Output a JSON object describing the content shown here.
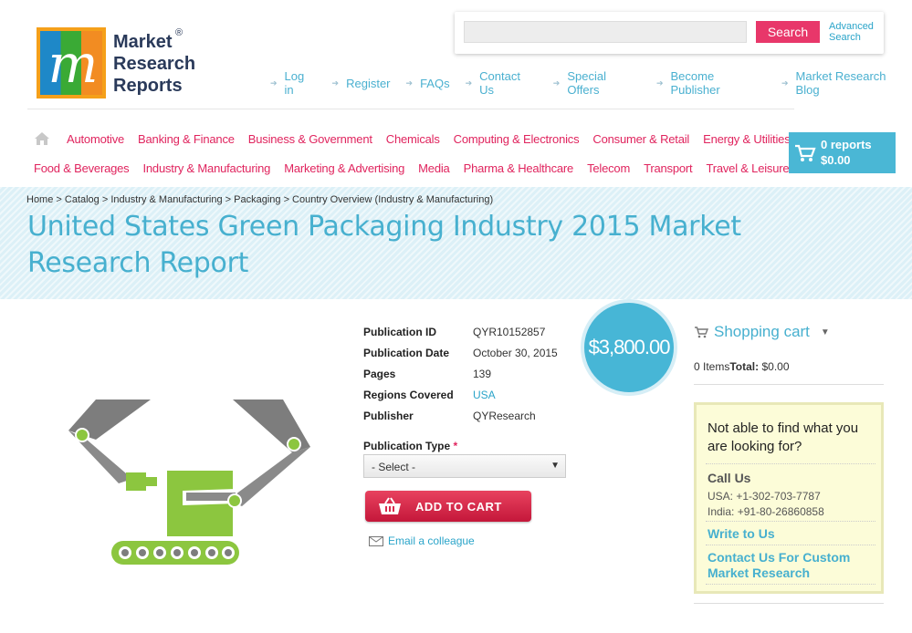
{
  "logo": {
    "line1": "Market",
    "line2": "Research",
    "line3": "Reports",
    "reg": "®",
    "letter": "m"
  },
  "search": {
    "placeholder": "",
    "button": "Search",
    "advanced": "Advanced Search"
  },
  "toplinks": [
    "Log in",
    "Register",
    "FAQs",
    "Contact Us",
    "Special Offers",
    "Become Publisher",
    "Market Research Blog"
  ],
  "nav": {
    "row1": [
      "Automotive",
      "Banking & Finance",
      "Business & Government",
      "Chemicals",
      "Computing & Electronics",
      "Consumer & Retail",
      "Energy & Utilities"
    ],
    "row2": [
      "Food & Beverages",
      "Industry & Manufacturing",
      "Marketing & Advertising",
      "Media",
      "Pharma & Healthcare",
      "Telecom",
      "Transport",
      "Travel & Leisure"
    ]
  },
  "cart": {
    "count": "0 reports",
    "total": "$0.00"
  },
  "breadcrumb": "Home > Catalog > Industry & Manufacturing > Packaging > Country Overview (Industry & Manufacturing)",
  "title": "United States Green Packaging Industry 2015 Market Research Report",
  "details": [
    {
      "label": "Publication ID",
      "value": "QYR10152857"
    },
    {
      "label": "Publication Date",
      "value": "October 30, 2015"
    },
    {
      "label": "Pages",
      "value": "139"
    },
    {
      "label": "Regions Covered",
      "value": "USA"
    },
    {
      "label": "Publisher",
      "value": "QYResearch"
    }
  ],
  "price": "$3,800.00",
  "publication_type": {
    "label": "Publication Type",
    "required": "*",
    "selected": "- Select -"
  },
  "add_to_cart": "ADD TO CART",
  "email": "Email a colleague",
  "sidebar": {
    "cart_title": "Shopping cart",
    "items": "0 Items",
    "total_label": "Total:",
    "total": "$0.00",
    "help_heading": "Not able to find what you are looking for?",
    "call_us": "Call Us",
    "phone_usa": "USA: +1-302-703-7787",
    "phone_india": "India: +91-80-26860858",
    "write_to_us": "Write to Us",
    "custom": "Contact Us For Custom Market Research"
  },
  "colors": {
    "accent": "#47b0cf",
    "pink": "#e0245e",
    "price_bg": "#47b6d6"
  }
}
